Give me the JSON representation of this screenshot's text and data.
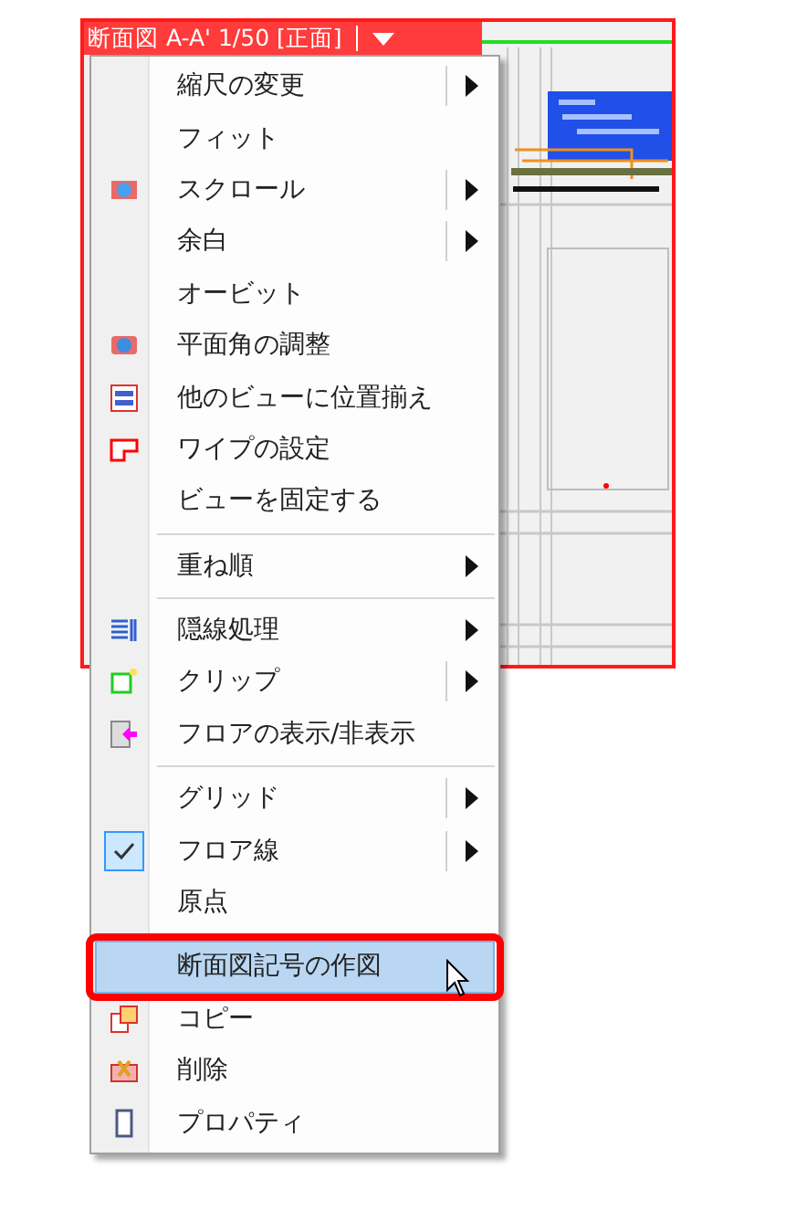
{
  "view": {
    "title": "断面図 A-A' 1/50 [正面]"
  },
  "menu": [
    {
      "kind": "item",
      "label": "縮尺の変更",
      "submenu": true,
      "split": true,
      "selected": false
    },
    {
      "kind": "item",
      "label": "フィット",
      "selected": false
    },
    {
      "kind": "item",
      "label": "スクロール",
      "submenu": true,
      "split": true,
      "selected": false
    },
    {
      "kind": "item",
      "label": "余白",
      "submenu": true,
      "split": true,
      "selected": false
    },
    {
      "kind": "item",
      "label": "オービット",
      "selected": false
    },
    {
      "kind": "item",
      "label": "平面角の調整",
      "selected": false
    },
    {
      "kind": "item",
      "label": "他のビューに位置揃え",
      "selected": false
    },
    {
      "kind": "item",
      "label": "ワイプの設定",
      "selected": false
    },
    {
      "kind": "item",
      "label": "ビューを固定する",
      "selected": false
    },
    {
      "kind": "separator"
    },
    {
      "kind": "item",
      "label": "重ね順",
      "submenu": true,
      "selected": false
    },
    {
      "kind": "separator"
    },
    {
      "kind": "item",
      "label": "隠線処理",
      "submenu": true,
      "selected": false
    },
    {
      "kind": "item",
      "label": "クリップ",
      "submenu": true,
      "split": true,
      "selected": false
    },
    {
      "kind": "item",
      "label": "フロアの表示/非表示",
      "selected": false
    },
    {
      "kind": "separator"
    },
    {
      "kind": "item",
      "label": "グリッド",
      "submenu": true,
      "split": true,
      "selected": false
    },
    {
      "kind": "item",
      "label": "フロア線",
      "checked": true,
      "submenu": true,
      "split": true,
      "selected": false
    },
    {
      "kind": "item",
      "label": "原点",
      "selected": false
    },
    {
      "kind": "separator"
    },
    {
      "kind": "item",
      "label": "断面図記号の作図",
      "selected": true,
      "outlined": true
    },
    {
      "kind": "item",
      "label": "コピー",
      "selected": false
    },
    {
      "kind": "item",
      "label": "削除",
      "selected": false
    },
    {
      "kind": "item",
      "label": "プロパティ",
      "selected": false
    }
  ]
}
